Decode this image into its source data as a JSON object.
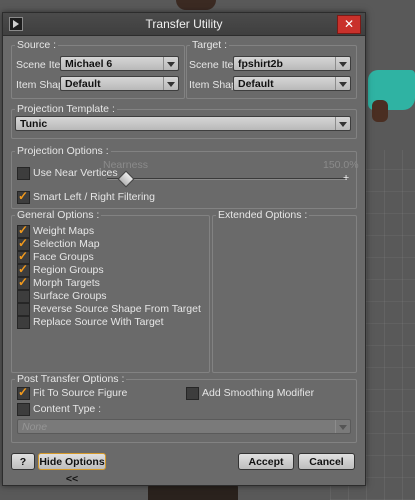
{
  "window": {
    "title": "Transfer Utility",
    "close_glyph": "✕"
  },
  "source": {
    "legend": "Source :",
    "scene_item_label": "Scene Item :",
    "scene_item_value": "Michael 6",
    "item_shape_label": "Item Shape :",
    "item_shape_value": "Default"
  },
  "target": {
    "legend": "Target :",
    "scene_item_label": "Scene Item :",
    "scene_item_value": "fpshirt2b",
    "item_shape_label": "Item Shape :",
    "item_shape_value": "Default"
  },
  "projection_template": {
    "legend": "Projection Template :",
    "value": "Tunic"
  },
  "projection_options": {
    "legend": "Projection Options :",
    "use_near_vertices": {
      "label": "Use Near Vertices",
      "checked": false
    },
    "nearness_label": "Nearness",
    "nearness_value": "150.0%",
    "smart_filtering": {
      "label": "Smart Left / Right Filtering",
      "checked": true
    }
  },
  "general_options": {
    "legend": "General Options :",
    "items": [
      {
        "label": "Weight Maps",
        "checked": true
      },
      {
        "label": "Selection Map",
        "checked": true
      },
      {
        "label": "Face Groups",
        "checked": true
      },
      {
        "label": "Region Groups",
        "checked": true
      },
      {
        "label": "Morph Targets",
        "checked": true
      },
      {
        "label": "Surface Groups",
        "checked": false
      },
      {
        "label": "Reverse Source Shape From Target",
        "checked": false
      },
      {
        "label": "Replace Source With Target",
        "checked": false
      }
    ]
  },
  "extended_options": {
    "legend": "Extended Options :"
  },
  "post_transfer": {
    "legend": "Post Transfer Options :",
    "fit_to_source": {
      "label": "Fit To Source Figure",
      "checked": true
    },
    "add_smoothing": {
      "label": "Add Smoothing Modifier",
      "checked": false
    },
    "content_type": {
      "label": "Content Type :",
      "checked": false
    },
    "content_type_value": "None"
  },
  "buttons": {
    "help": "?",
    "hide_options": "Hide Options <<",
    "accept": "Accept",
    "cancel": "Cancel"
  }
}
